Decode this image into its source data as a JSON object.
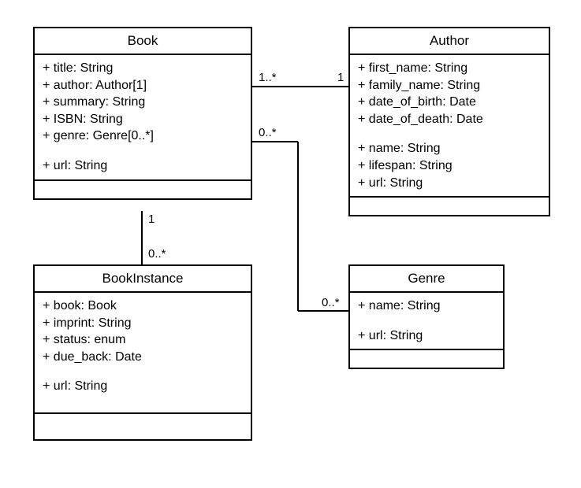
{
  "classes": {
    "book": {
      "title": "Book",
      "attrs": {
        "a0": "+ title: String",
        "a1": "+ author: Author[1]",
        "a2": "+ summary: String",
        "a3": "+ ISBN: String",
        "a4": "+ genre: Genre[0..*]",
        "a5": "+ url: String"
      }
    },
    "author": {
      "title": "Author",
      "attrs": {
        "a0": "+ first_name: String",
        "a1": "+ family_name: String",
        "a2": "+ date_of_birth: Date",
        "a3": "+ date_of_death: Date",
        "a4": "+ name: String",
        "a5": "+ lifespan: String",
        "a6": "+ url: String"
      }
    },
    "bookinstance": {
      "title": "BookInstance",
      "attrs": {
        "a0": "+ book: Book",
        "a1": "+ imprint: String",
        "a2": "+ status: enum",
        "a3": "+ due_back: Date",
        "a4": "+ url: String"
      }
    },
    "genre": {
      "title": "Genre",
      "attrs": {
        "a0": "+ name: String",
        "a1": "+ url: String"
      }
    }
  },
  "multiplicities": {
    "book_author_left": "1..*",
    "book_author_right": "1",
    "book_genre_top": "0..*",
    "book_genre_bottom": "0..*",
    "book_bookinstance_top": "1",
    "book_bookinstance_bottom": "0..*"
  }
}
